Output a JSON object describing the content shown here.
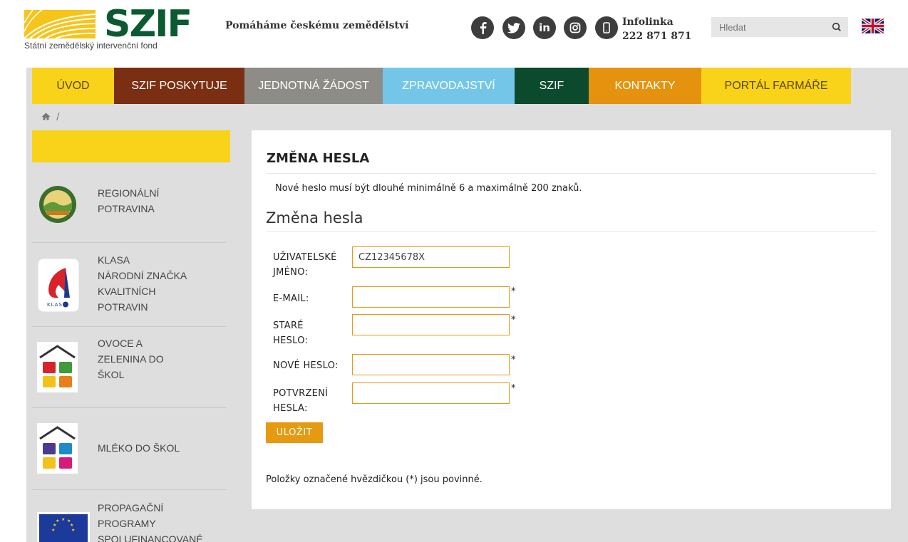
{
  "header": {
    "logo_text": "SZIF",
    "logo_subtitle": "Státní zemědělský intervenční fond",
    "tagline": "Pomáháme českému zemědělství",
    "social_icons": [
      "facebook-icon",
      "twitter-icon",
      "linkedin-icon",
      "instagram-icon",
      "mobile-icon"
    ],
    "infolinka_label": "Infolinka",
    "infolinka_number": "222 871 871",
    "search_placeholder": "Hledat",
    "language_flag": "uk-flag-icon"
  },
  "nav": {
    "items": [
      {
        "label": "ÚVOD",
        "bg": "#f9d21a",
        "color": "#5a4a00"
      },
      {
        "label": "SZIF POSKYTUJE",
        "bg": "#7a2f12",
        "color": "#ffffff"
      },
      {
        "label": "JEDNOTNÁ ŽÁDOST",
        "bg": "#8e8c87",
        "color": "#ffffff"
      },
      {
        "label": "ZPRAVODAJSTVÍ",
        "bg": "#74c6e8",
        "color": "#ffffff"
      },
      {
        "label": "SZIF",
        "bg": "#0b4a2c",
        "color": "#ffffff"
      },
      {
        "label": "KONTAKTY",
        "bg": "#e5930f",
        "color": "#ffffff"
      },
      {
        "label": "PORTÁL FARMÁŘE",
        "bg": "#f9d21a",
        "color": "#5a4a00"
      }
    ]
  },
  "breadcrumb": {
    "icon": "home-icon",
    "separator": "/"
  },
  "sidebar": {
    "items": [
      {
        "lines": [
          "REGIONÁLNÍ",
          "POTRAVINA"
        ],
        "icon": "regionalni-potravina-icon"
      },
      {
        "lines": [
          "KLASA",
          "NÁRODNÍ ZNAČKA",
          "KVALITNÍCH",
          "POTRAVIN"
        ],
        "icon": "klasa-icon"
      },
      {
        "lines": [
          "OVOCE A",
          "ZELENINA DO",
          "ŠKOL"
        ],
        "icon": "ovoce-zelenina-icon"
      },
      {
        "lines": [
          "MLÉKO DO ŠKOL"
        ],
        "icon": "mleko-icon"
      },
      {
        "lines": [
          "PROPAGAČNÍ",
          "PROGRAMY",
          "SPOLUFINANCOVANÉ"
        ],
        "icon": "eu-flag-icon"
      }
    ]
  },
  "main": {
    "title": "ZMĚNA HESLA",
    "info": "Nové heslo musí být dlouhé minimálně 6 a maximálně 200 znaků.",
    "subtitle": "Změna hesla",
    "fields": {
      "username": {
        "label1": "UŽIVATELSKÉ",
        "label2": "JMÉNO:",
        "value": "CZ12345678X"
      },
      "email": {
        "label1": "E-MAIL:",
        "value": "",
        "required": "*"
      },
      "old_password": {
        "label1": "STARÉ",
        "label2": "HESLO:",
        "value": "",
        "required": "*"
      },
      "new_password": {
        "label1": "NOVÉ HESLO:",
        "value": "",
        "required": "*"
      },
      "confirm_password": {
        "label1": "POTVRZENÍ",
        "label2": "HESLA:",
        "value": "",
        "required": "*"
      }
    },
    "save_label": "ULOŽIT",
    "required_note": "Položky označené hvězdičkou (*) jsou povinné."
  }
}
